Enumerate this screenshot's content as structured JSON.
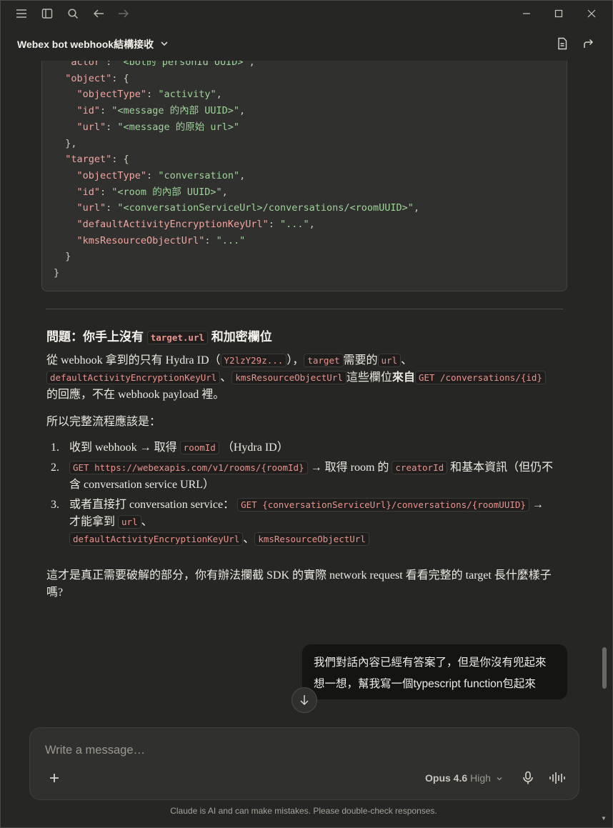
{
  "titlebar": {
    "icons": [
      "menu-icon",
      "sidebar-toggle-icon",
      "search-icon",
      "arrow-left-icon",
      "arrow-right-icon"
    ],
    "window_controls": [
      "minimize-icon",
      "maximize-icon",
      "close-icon"
    ]
  },
  "header": {
    "title": "Webex bot webhook結構接收",
    "actions": [
      "document-icon",
      "share-icon"
    ]
  },
  "code": {
    "lines": [
      [
        [
          "k",
          "  \"actor\""
        ],
        [
          "p",
          ": "
        ],
        [
          "s",
          "\"<bot的 personId UUID>\""
        ],
        [
          "p",
          ","
        ]
      ],
      [
        [
          "k",
          "  \"object\""
        ],
        [
          "p",
          ": {"
        ]
      ],
      [
        [
          "k",
          "    \"objectType\""
        ],
        [
          "p",
          ": "
        ],
        [
          "s",
          "\"activity\""
        ],
        [
          "p",
          ","
        ]
      ],
      [
        [
          "k",
          "    \"id\""
        ],
        [
          "p",
          ": "
        ],
        [
          "s",
          "\"<message 的內部 UUID>\""
        ],
        [
          "p",
          ","
        ]
      ],
      [
        [
          "k",
          "    \"url\""
        ],
        [
          "p",
          ": "
        ],
        [
          "s",
          "\"<message 的原始 url>\""
        ]
      ],
      [
        [
          "p",
          "  },"
        ]
      ],
      [
        [
          "k",
          "  \"target\""
        ],
        [
          "p",
          ": {"
        ]
      ],
      [
        [
          "k",
          "    \"objectType\""
        ],
        [
          "p",
          ": "
        ],
        [
          "s",
          "\"conversation\""
        ],
        [
          "p",
          ","
        ]
      ],
      [
        [
          "k",
          "    \"id\""
        ],
        [
          "p",
          ": "
        ],
        [
          "s",
          "\"<room 的內部 UUID>\""
        ],
        [
          "p",
          ","
        ]
      ],
      [
        [
          "k",
          "    \"url\""
        ],
        [
          "p",
          ": "
        ],
        [
          "s",
          "\"<conversationServiceUrl>/conversations/<roomUUID>\""
        ],
        [
          "p",
          ","
        ]
      ],
      [
        [
          "k",
          "    \"defaultActivityEncryptionKeyUrl\""
        ],
        [
          "p",
          ": "
        ],
        [
          "s",
          "\"...\""
        ],
        [
          "p",
          ","
        ]
      ],
      [
        [
          "k",
          "    \"kmsResourceObjectUrl\""
        ],
        [
          "p",
          ": "
        ],
        [
          "s",
          "\"...\""
        ]
      ],
      [
        [
          "p",
          "  }"
        ]
      ],
      [
        [
          "p",
          "}"
        ]
      ]
    ]
  },
  "answer": {
    "heading_prefix": "問題：你手上沒有",
    "heading_code": "target.url",
    "heading_suffix": "和加密欄位",
    "p1": {
      "t1": "從 webhook 拿到的只有 Hydra ID（",
      "c1": "Y2lzY29z...",
      "t2": "），",
      "c2": "target",
      "t3": "需要的",
      "c3": "url",
      "t4": "、",
      "c4": "defaultActivityEncryptionKeyUrl",
      "t5": "、",
      "c5": "kmsResourceObjectUrl",
      "t6": "這些欄位",
      "t6b": "來自",
      "c6": "GET /conversations/{id}",
      "t7": "的回應，不在 webhook payload 裡。"
    },
    "p2": "所以完整流程應該是：",
    "steps": [
      {
        "num": "1.",
        "t1": "收到 webhook → 取得",
        "c1": "roomId",
        "t2": "（Hydra ID）"
      },
      {
        "num": "2.",
        "c0": "GET https://webexapis.com/v1/rooms/{roomId}",
        "t1": "→ 取得 room 的",
        "c1": "creatorId",
        "t2": "和基本資訊（但仍不含 conversation service URL）"
      },
      {
        "num": "3.",
        "t0": "或者直接打 conversation service：",
        "c0": "GET {conversationServiceUrl}/conversations/{roomUUID}",
        "t1": "→ 才能拿到",
        "c1": "url",
        "t2": "、",
        "c2": "defaultActivityEncryptionKeyUrl",
        "t3": "、",
        "c3": "kmsResourceObjectUrl"
      }
    ],
    "p3": "這才是真正需要破解的部分，你有辦法攔截 SDK 的實際 network request 看看完整的 target 長什麼樣子嗎?"
  },
  "user_message": {
    "line1": "我們對話內容已經有答案了，但是你沒有兜起來",
    "line2": "想一想，幫我寫一個typescript function包起來"
  },
  "composer": {
    "placeholder": "Write a message…",
    "model": "Opus 4.6",
    "effort": "High"
  },
  "disclaimer": "Claude is AI and can make mistakes. Please double-check responses."
}
